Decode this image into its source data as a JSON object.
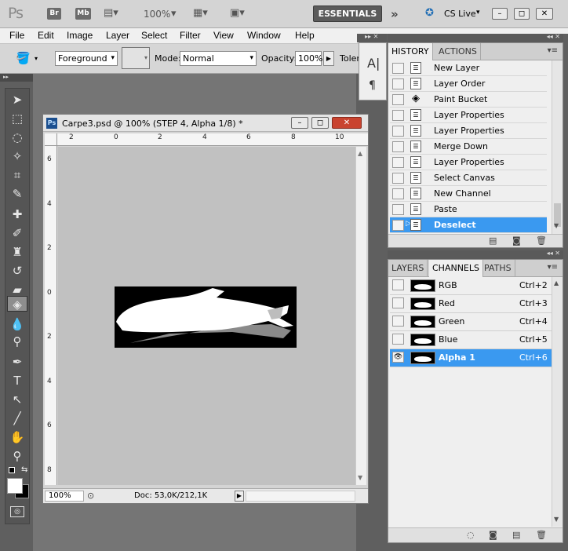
{
  "appbar": {
    "logo": "Ps",
    "bridge": "Br",
    "minibridge": "Mb",
    "zoom": "100%",
    "workspace": "ESSENTIALS",
    "cslive": "CS Live",
    "more": "»"
  },
  "menu": [
    "File",
    "Edit",
    "Image",
    "Layer",
    "Select",
    "Filter",
    "View",
    "Window",
    "Help"
  ],
  "options": {
    "fill_source": "Foreground",
    "mode_label": "Mode:",
    "mode_value": "Normal",
    "opacity_label": "Opacity:",
    "opacity_value": "100%",
    "tolerance_label": "Toler"
  },
  "document": {
    "title": "Carpe3.psd @ 100% (STEP 4, Alpha 1/8) *",
    "icon": "Ps",
    "zoom": "100%",
    "doc_info": "Doc: 53,0K/212,1K",
    "ruler_h": [
      "2",
      "0",
      "2",
      "4",
      "6",
      "8",
      "10"
    ],
    "ruler_v": [
      "6",
      "4",
      "2",
      "0",
      "2",
      "4",
      "6",
      "8"
    ]
  },
  "history": {
    "tabs": [
      "HISTORY",
      "ACTIONS"
    ],
    "items": [
      "New Layer",
      "Layer Order",
      "Paint Bucket",
      "Layer Properties",
      "Layer Properties",
      "Merge Down",
      "Layer Properties",
      "Select Canvas",
      "New Channel",
      "Paste",
      "Deselect"
    ],
    "selected": "Deselect"
  },
  "channels": {
    "tabs": [
      "LAYERS",
      "CHANNELS",
      "PATHS"
    ],
    "items": [
      {
        "name": "RGB",
        "key": "Ctrl+2"
      },
      {
        "name": "Red",
        "key": "Ctrl+3"
      },
      {
        "name": "Green",
        "key": "Ctrl+4"
      },
      {
        "name": "Blue",
        "key": "Ctrl+5"
      },
      {
        "name": "Alpha 1",
        "key": "Ctrl+6"
      }
    ]
  },
  "colors": {
    "accent": "#3a99f0",
    "panel": "#efefef",
    "dark": "#5f5f5f"
  }
}
